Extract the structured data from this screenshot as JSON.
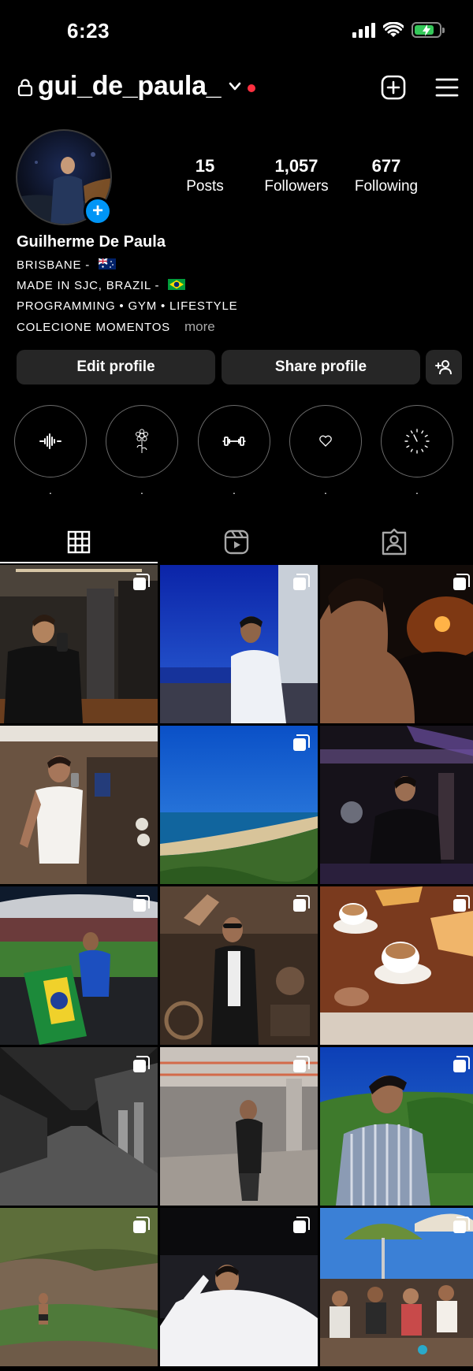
{
  "status_bar": {
    "time": "6:23"
  },
  "header": {
    "username": "gui_de_paula_"
  },
  "profile": {
    "stats": [
      {
        "value": "15",
        "label": "Posts"
      },
      {
        "value": "1,057",
        "label": "Followers"
      },
      {
        "value": "677",
        "label": "Following"
      }
    ],
    "name": "Guilherme De Paula",
    "bio": [
      "BRISBANE  -",
      "MADE IN SJC, BRAZIL -",
      "PROGRAMMING • GYM • LIFESTYLE",
      "COLECIONE MOMENTOS"
    ],
    "more_label": "more"
  },
  "actions": {
    "edit_label": "Edit profile",
    "share_label": "Share profile"
  },
  "highlights": [
    {
      "icon": "sound-wave-icon",
      "label": "."
    },
    {
      "icon": "flower-icon",
      "label": "."
    },
    {
      "icon": "dumbbell-icon",
      "label": "."
    },
    {
      "icon": "heart-icon",
      "label": "."
    },
    {
      "icon": "clock-icon",
      "label": "."
    }
  ],
  "tabs": [
    {
      "icon": "grid-icon",
      "active": true
    },
    {
      "icon": "reels-icon",
      "active": false
    },
    {
      "icon": "tagged-icon",
      "active": false
    }
  ],
  "colors": {
    "accent_blue": "#0095f6",
    "notification_red": "#ff3040",
    "button_bg": "#262626",
    "battery_green": "#34c759"
  },
  "posts": [
    {
      "scene": "elevator mirror selfie",
      "multi": true
    },
    {
      "scene": "blue sky balcony",
      "multi": true
    },
    {
      "scene": "night concert crowd",
      "multi": true
    },
    {
      "scene": "gym mirror selfie",
      "multi": false
    },
    {
      "scene": "beach coastline",
      "multi": true
    },
    {
      "scene": "night restaurant",
      "multi": false
    },
    {
      "scene": "stadium with brazil flag",
      "multi": true
    },
    {
      "scene": "antique shop selfie",
      "multi": true
    },
    {
      "scene": "coffee and toast",
      "multi": true
    },
    {
      "scene": "black and white street",
      "multi": true
    },
    {
      "scene": "parking garage",
      "multi": true
    },
    {
      "scene": "striped shirt portrait",
      "multi": true
    },
    {
      "scene": "waterfall rocks",
      "multi": true
    },
    {
      "scene": "white shirt studio",
      "multi": true
    },
    {
      "scene": "beach bar friends",
      "multi": true
    }
  ]
}
